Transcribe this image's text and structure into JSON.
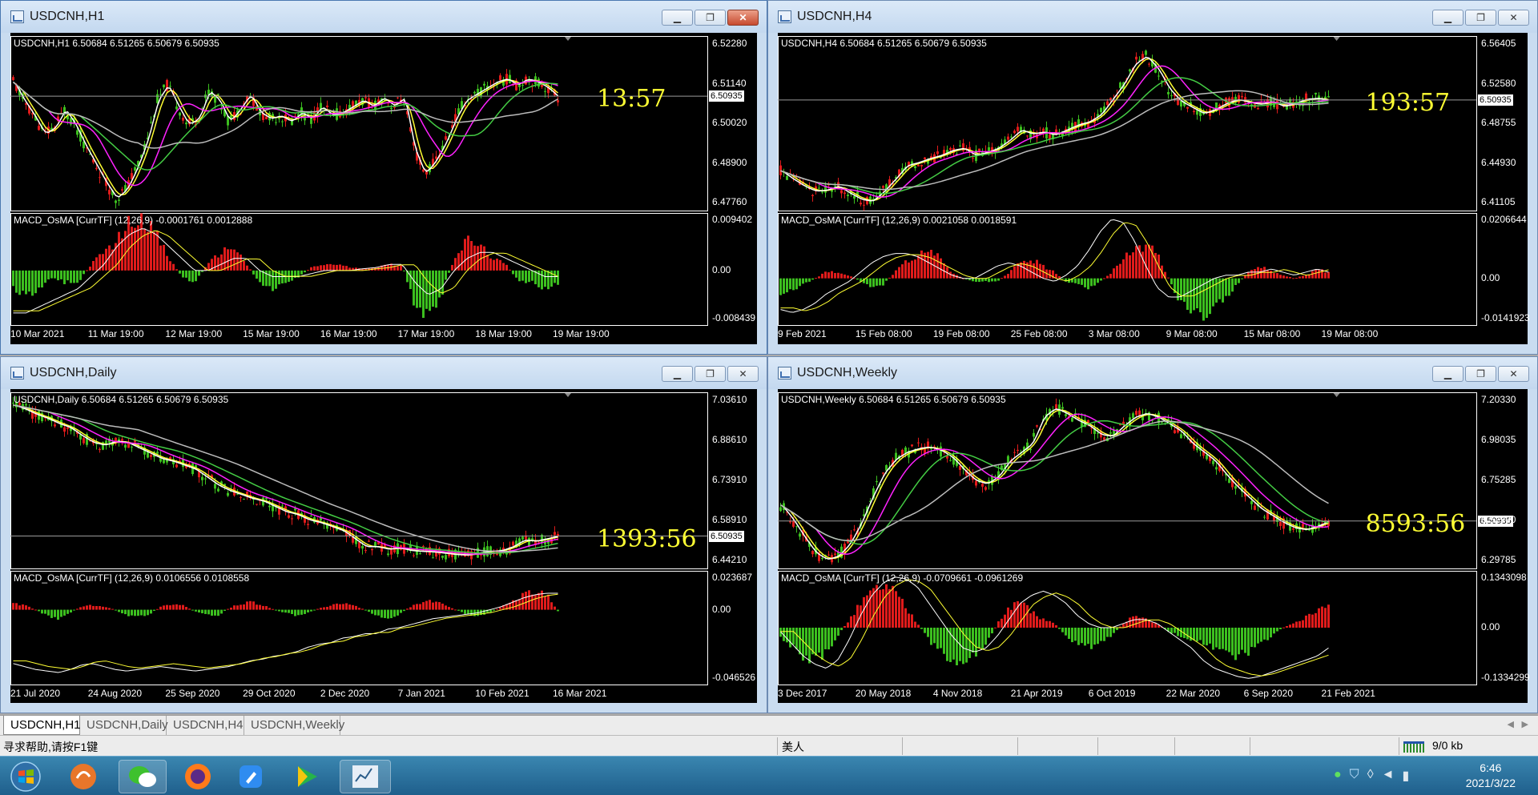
{
  "windows": [
    {
      "id": "h1",
      "title": "USDCNH,H1",
      "active": true,
      "info": "USDCNH,H1  6.50684 6.51265 6.50679 6.50935",
      "macd_label": "MACD_OsMA [CurrTF] (12,26,9) -0.0001761 0.0012888",
      "countdown": "13:57",
      "current_price": "6.50935",
      "price_ticks": [
        "6.52280",
        "6.51140",
        "6.50020",
        "6.48900",
        "6.47760"
      ],
      "macd_ticks": [
        "0.009402",
        "0.00",
        "-0.008439"
      ],
      "date_ticks": [
        "10 Mar 2021",
        "11 Mar 19:00",
        "12 Mar 19:00",
        "15 Mar 19:00",
        "16 Mar 19:00",
        "17 Mar 19:00",
        "18 Mar 19:00",
        "19 Mar 19:00"
      ],
      "price_range": [
        6.472,
        6.529
      ],
      "macd_range": [
        -0.009,
        0.0095
      ],
      "seed": 11,
      "close": [
        6.514,
        6.508,
        6.503,
        6.497,
        6.499,
        6.505,
        6.5,
        6.493,
        6.487,
        6.481,
        6.476,
        6.479,
        6.486,
        6.495,
        6.508,
        6.513,
        6.506,
        6.5,
        6.502,
        6.511,
        6.508,
        6.501,
        6.505,
        6.51,
        6.504,
        6.502,
        6.503,
        6.501,
        6.504,
        6.502,
        6.506,
        6.503,
        6.504,
        6.506,
        6.508,
        6.506,
        6.509,
        6.506,
        6.509,
        6.492,
        6.484,
        6.488,
        6.494,
        6.502,
        6.508,
        6.51,
        6.512,
        6.514,
        6.515,
        6.513,
        6.515,
        6.514,
        6.512,
        6.509
      ],
      "macd_hist": [
        -0.003,
        -0.004,
        -0.003,
        -0.001,
        -0.002,
        -0.002,
        0.001,
        0.003,
        0.005,
        0.008,
        0.009,
        0.006,
        0.002,
        -0.001,
        -0.002,
        0.001,
        0.003,
        0.004,
        0.001,
        -0.002,
        -0.003,
        -0.002,
        -0.001,
        0.0005,
        0.001,
        0.001,
        0.0005,
        0.0003,
        0.0005,
        0.001,
        0.0008,
        -0.006,
        -0.008,
        -0.004,
        0.002,
        0.005,
        0.004,
        0.002,
        0.001,
        -0.002,
        -0.002,
        -0.003,
        -0.002
      ],
      "macd_sig": [
        -0.007,
        -0.007,
        -0.006,
        -0.005,
        -0.004,
        -0.003,
        -0.001,
        0.001,
        0.004,
        0.006,
        0.007,
        0.006,
        0.004,
        0.002,
        0.0,
        0.0,
        0.001,
        0.002,
        0.002,
        0.0,
        -0.001,
        -0.001,
        -0.001,
        -0.0005,
        0.0,
        0.0,
        0.0,
        0.0003,
        0.0005,
        0.001,
        0.001,
        -0.002,
        -0.004,
        -0.003,
        0.0,
        0.002,
        0.003,
        0.003,
        0.002,
        0.001,
        0.0,
        -0.001,
        -0.001
      ]
    },
    {
      "id": "h4",
      "title": "USDCNH,H4",
      "active": false,
      "info": "USDCNH,H4  6.50684 6.51265 6.50679 6.50935",
      "macd_label": "MACD_OsMA [CurrTF] (12,26,9) 0.0021058 0.0018591",
      "countdown": "193:57",
      "current_price": "6.50935",
      "price_ticks": [
        "6.56405",
        "6.52580",
        "6.48755",
        "6.44930",
        "6.41105"
      ],
      "macd_ticks": [
        "0.0206644",
        "0.00",
        "-0.0141923"
      ],
      "date_ticks": [
        "9 Feb 2021",
        "15 Feb 08:00",
        "19 Feb 08:00",
        "25 Feb 08:00",
        "3 Mar 08:00",
        "9 Mar 08:00",
        "15 Mar 08:00",
        "19 Mar 08:00"
      ],
      "price_range": [
        6.401,
        6.572
      ],
      "macd_range": [
        -0.015,
        0.021
      ],
      "seed": 23,
      "close": [
        6.44,
        6.432,
        6.425,
        6.42,
        6.421,
        6.425,
        6.418,
        6.412,
        6.41,
        6.42,
        6.432,
        6.445,
        6.448,
        6.452,
        6.455,
        6.46,
        6.462,
        6.455,
        6.458,
        6.462,
        6.47,
        6.48,
        6.476,
        6.478,
        6.475,
        6.48,
        6.485,
        6.488,
        6.495,
        6.51,
        6.525,
        6.545,
        6.552,
        6.54,
        6.52,
        6.508,
        6.502,
        6.496,
        6.5,
        6.506,
        6.51,
        6.507,
        6.505,
        6.508,
        6.503,
        6.506,
        6.51,
        6.511,
        6.509
      ],
      "macd_hist": [
        -0.005,
        -0.004,
        -0.002,
        0.0,
        0.002,
        0.002,
        0.001,
        -0.001,
        -0.003,
        -0.002,
        0.002,
        0.005,
        0.008,
        0.009,
        0.006,
        0.002,
        0.0,
        -0.001,
        -0.001,
        -0.001,
        0.002,
        0.005,
        0.006,
        0.004,
        0.002,
        -0.001,
        -0.002,
        -0.003,
        -0.001,
        0.002,
        0.006,
        0.009,
        0.011,
        0.008,
        0.0,
        -0.008,
        -0.011,
        -0.012,
        -0.01,
        -0.006,
        -0.002,
        0.002,
        0.004,
        0.002,
        0.001,
        0.0,
        0.001,
        0.003,
        0.002
      ],
      "macd_sig": [
        -0.01,
        -0.011,
        -0.01,
        -0.008,
        -0.005,
        -0.003,
        -0.001,
        0.002,
        0.005,
        0.007,
        0.008,
        0.008,
        0.007,
        0.005,
        0.003,
        0.001,
        0.0,
        0.0,
        0.002,
        0.004,
        0.005,
        0.004,
        0.002,
        0.0,
        -0.001,
        0.001,
        0.004,
        0.009,
        0.015,
        0.019,
        0.018,
        0.012,
        0.004,
        -0.003,
        -0.006,
        -0.006,
        -0.004,
        -0.002,
        0.0,
        0.001,
        0.001,
        0.002,
        0.002,
        0.003,
        0.002,
        0.001,
        0.002,
        0.003,
        0.002
      ]
    },
    {
      "id": "daily",
      "title": "USDCNH,Daily",
      "active": false,
      "info": "USDCNH,Daily  6.50684 6.51265 6.50679 6.50935",
      "macd_label": "MACD_OsMA [CurrTF] (12,26,9) 0.0106556 0.0108558",
      "countdown": "1393:56",
      "current_price": "6.50935",
      "price_ticks": [
        "7.03610",
        "6.88610",
        "6.73910",
        "6.58910",
        "6.44210"
      ],
      "macd_ticks": [
        "0.023687",
        "0.00",
        "-0.046526"
      ],
      "date_ticks": [
        "21 Jul 2020",
        "24 Aug 2020",
        "25 Sep 2020",
        "29 Oct 2020",
        "2 Dec 2020",
        "7 Jan 2021",
        "10 Feb 2021",
        "16 Mar 2021"
      ],
      "price_range": [
        6.388,
        7.048
      ],
      "macd_range": [
        -0.05,
        0.026
      ],
      "seed": 37,
      "close": [
        7.0,
        6.985,
        6.965,
        6.95,
        6.93,
        6.915,
        6.885,
        6.86,
        6.85,
        6.865,
        6.86,
        6.84,
        6.82,
        6.8,
        6.79,
        6.775,
        6.76,
        6.73,
        6.7,
        6.68,
        6.665,
        6.65,
        6.64,
        6.62,
        6.6,
        6.59,
        6.57,
        6.56,
        6.545,
        6.53,
        6.5,
        6.47,
        6.47,
        6.46,
        6.465,
        6.455,
        6.452,
        6.45,
        6.445,
        6.44,
        6.438,
        6.446,
        6.452,
        6.455,
        6.47,
        6.495,
        6.49,
        6.5,
        6.509
      ],
      "macd_hist": [
        0.004,
        0.003,
        0.0,
        -0.004,
        -0.006,
        -0.002,
        0.002,
        0.003,
        0.002,
        0.0,
        -0.004,
        -0.005,
        -0.003,
        0.002,
        0.004,
        0.003,
        -0.001,
        -0.003,
        -0.004,
        0.001,
        0.004,
        0.005,
        0.003,
        0.0,
        -0.002,
        -0.004,
        -0.002,
        0.001,
        0.003,
        0.004,
        0.003,
        0.0,
        -0.004,
        -0.006,
        -0.003,
        0.002,
        0.005,
        0.006,
        0.003,
        0.0,
        -0.003,
        -0.004,
        -0.002,
        0.002,
        0.006,
        0.01,
        0.012,
        0.011,
        -0.001
      ],
      "macd_sig": [
        -0.036,
        -0.038,
        -0.04,
        -0.041,
        -0.042,
        -0.04,
        -0.037,
        -0.036,
        -0.038,
        -0.04,
        -0.041,
        -0.04,
        -0.039,
        -0.038,
        -0.039,
        -0.04,
        -0.041,
        -0.04,
        -0.039,
        -0.038,
        -0.036,
        -0.034,
        -0.033,
        -0.031,
        -0.03,
        -0.028,
        -0.025,
        -0.023,
        -0.022,
        -0.019,
        -0.018,
        -0.016,
        -0.016,
        -0.013,
        -0.012,
        -0.01,
        -0.008,
        -0.006,
        -0.005,
        -0.004,
        -0.003,
        -0.002,
        0.0,
        0.002,
        0.005,
        0.008,
        0.01,
        0.011,
        0.011
      ]
    },
    {
      "id": "weekly",
      "title": "USDCNH,Weekly",
      "active": false,
      "info": "USDCNH,Weekly  6.50684 6.51265 6.50679 6.50935",
      "macd_label": "MACD_OsMA [CurrTF] (12,26,9) -0.0709661 -0.0961269",
      "countdown": "8593:56",
      "current_price": "6.50935",
      "price_ticks": [
        "7.20330",
        "6.98035",
        "6.75285",
        "6.52990",
        "6.29785"
      ],
      "macd_ticks": [
        "0.1343098",
        "0.00",
        "-0.1334299"
      ],
      "date_ticks": [
        "3 Dec 2017",
        "20 May 2018",
        "4 Nov 2018",
        "21 Apr 2019",
        "6 Oct 2019",
        "22 Mar 2020",
        "6 Sep 2020",
        "21 Feb 2021"
      ],
      "price_range": [
        6.24,
        7.24
      ],
      "macd_range": [
        -0.14,
        0.14
      ],
      "seed": 53,
      "close": [
        6.6,
        6.52,
        6.42,
        6.33,
        6.29,
        6.31,
        6.38,
        6.5,
        6.65,
        6.78,
        6.86,
        6.9,
        6.92,
        6.93,
        6.91,
        6.87,
        6.8,
        6.74,
        6.72,
        6.76,
        6.85,
        6.9,
        6.95,
        7.1,
        7.15,
        7.12,
        7.08,
        7.05,
        7.0,
        6.99,
        7.05,
        7.1,
        7.12,
        7.1,
        7.06,
        7.02,
        6.95,
        6.9,
        6.85,
        6.77,
        6.7,
        6.64,
        6.58,
        6.54,
        6.5,
        6.47,
        6.46,
        6.48,
        6.509
      ],
      "macd_hist": [
        -0.02,
        -0.05,
        -0.07,
        -0.08,
        -0.06,
        -0.02,
        0.02,
        0.06,
        0.09,
        0.11,
        0.09,
        0.05,
        0.01,
        -0.03,
        -0.06,
        -0.08,
        -0.09,
        -0.07,
        -0.04,
        0.01,
        0.05,
        0.06,
        0.04,
        0.02,
        0.01,
        -0.02,
        -0.04,
        -0.05,
        -0.04,
        -0.02,
        0.01,
        0.03,
        0.02,
        0.01,
        -0.01,
        -0.02,
        -0.03,
        -0.04,
        -0.05,
        -0.06,
        -0.07,
        -0.06,
        -0.04,
        -0.02,
        0.0,
        0.01,
        0.025,
        0.04,
        0.05
      ],
      "macd_sig": [
        -0.01,
        -0.04,
        -0.07,
        -0.09,
        -0.1,
        -0.08,
        -0.03,
        0.03,
        0.08,
        0.11,
        0.125,
        0.12,
        0.1,
        0.06,
        0.02,
        -0.02,
        -0.05,
        -0.06,
        -0.05,
        -0.02,
        0.02,
        0.06,
        0.08,
        0.09,
        0.08,
        0.06,
        0.03,
        0.01,
        0.0,
        0.0,
        0.01,
        0.02,
        0.02,
        0.01,
        -0.01,
        -0.03,
        -0.05,
        -0.08,
        -0.1,
        -0.11,
        -0.12,
        -0.125,
        -0.12,
        -0.11,
        -0.1,
        -0.09,
        -0.08,
        -0.07,
        -0.05
      ]
    }
  ],
  "tabs": [
    "USDCNH,H1",
    "USDCNH,Daily",
    "USDCNH,H4",
    "USDCNH,Weekly"
  ],
  "active_tab": 0,
  "status": {
    "help": "寻求帮助,请按F1键",
    "profile": "美人",
    "traffic": "9/0 kb"
  },
  "taskbar": {
    "time": "6:46",
    "date": "2021/3/22"
  },
  "colors": {
    "bull": "#3cbf1f",
    "bear": "#e01b1b",
    "ma_yellow": "#ffff33",
    "ma_white": "#ffffff",
    "ma_magenta": "#ff22ff",
    "ma_green": "#44cc44",
    "ma_gray": "#bcbcbc",
    "countdown": "#ffff33"
  }
}
